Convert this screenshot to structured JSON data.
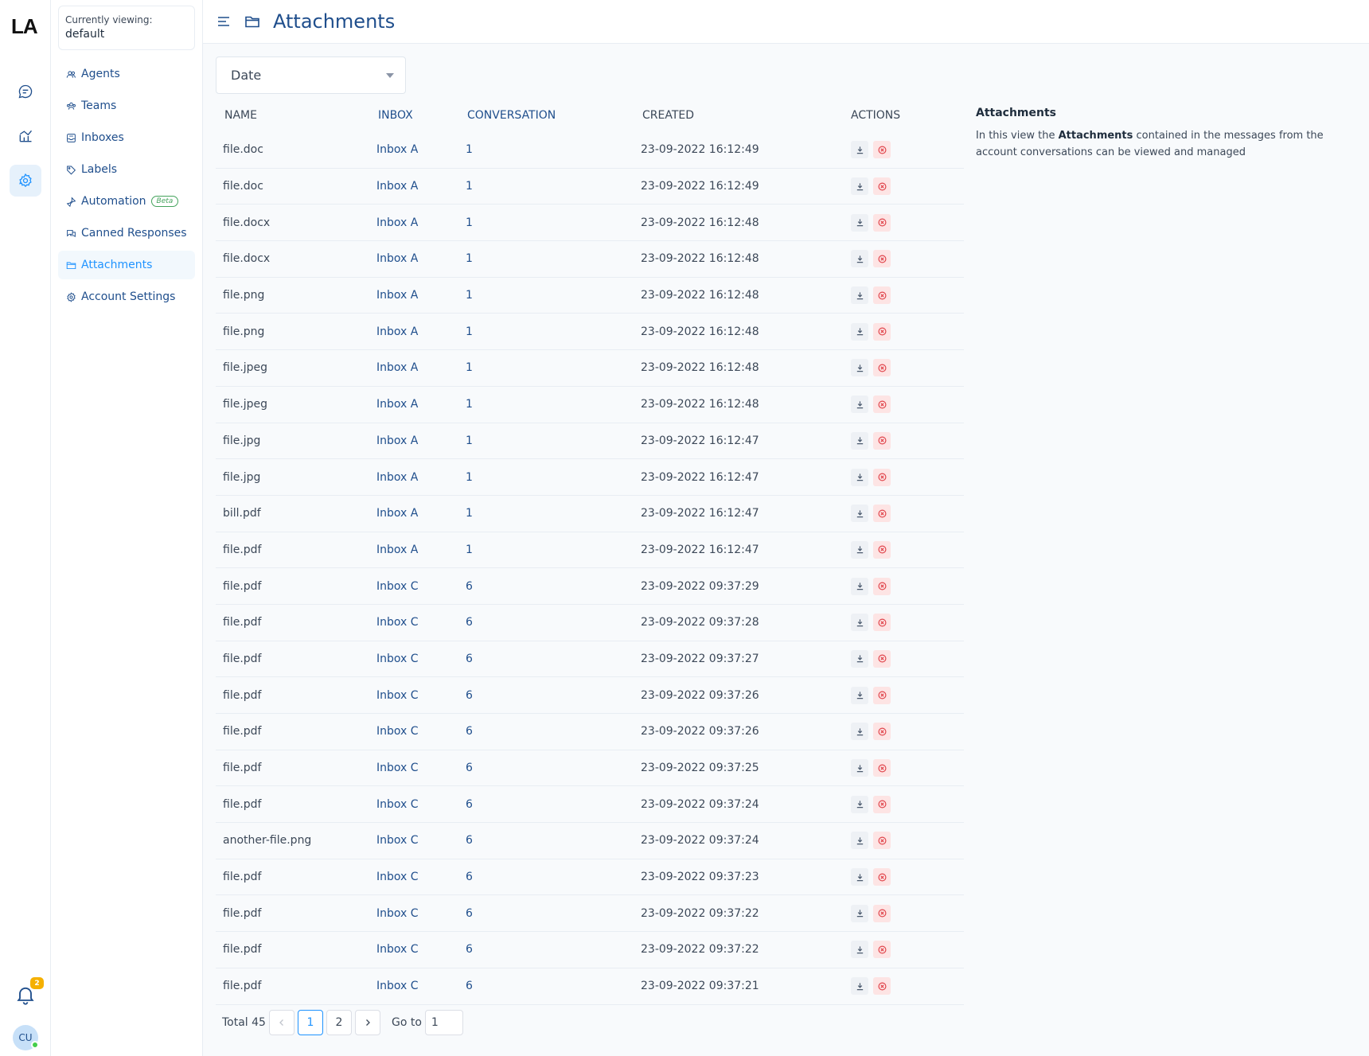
{
  "app": {
    "logo": "LA"
  },
  "rail": {
    "items": [
      {
        "name": "conversations",
        "icon": "chat-icon"
      },
      {
        "name": "reports",
        "icon": "chart-icon"
      },
      {
        "name": "settings",
        "icon": "gear-icon",
        "active": true
      }
    ],
    "notifications_count": "2",
    "avatar_initials": "CU"
  },
  "sidebar": {
    "viewing_label": "Currently viewing:",
    "viewing_value": "default",
    "items": [
      {
        "label": "Agents",
        "icon": "agents-icon"
      },
      {
        "label": "Teams",
        "icon": "teams-icon"
      },
      {
        "label": "Inboxes",
        "icon": "inbox-icon"
      },
      {
        "label": "Labels",
        "icon": "tag-icon"
      },
      {
        "label": "Automation",
        "icon": "automation-icon",
        "badge": "Beta"
      },
      {
        "label": "Canned Responses",
        "icon": "canned-icon"
      },
      {
        "label": "Attachments",
        "icon": "folder-icon",
        "active": true
      },
      {
        "label": "Account Settings",
        "icon": "gear-icon"
      }
    ]
  },
  "header": {
    "title": "Attachments"
  },
  "filter": {
    "selected": "Date"
  },
  "table": {
    "columns": [
      "NAME",
      "INBOX",
      "CONVERSATION",
      "CREATED",
      "ACTIONS"
    ],
    "rows": [
      [
        "file.doc",
        "Inbox A",
        "1",
        "23-09-2022 16:12:49"
      ],
      [
        "file.doc",
        "Inbox A",
        "1",
        "23-09-2022 16:12:49"
      ],
      [
        "file.docx",
        "Inbox A",
        "1",
        "23-09-2022 16:12:48"
      ],
      [
        "file.docx",
        "Inbox A",
        "1",
        "23-09-2022 16:12:48"
      ],
      [
        "file.png",
        "Inbox A",
        "1",
        "23-09-2022 16:12:48"
      ],
      [
        "file.png",
        "Inbox A",
        "1",
        "23-09-2022 16:12:48"
      ],
      [
        "file.jpeg",
        "Inbox A",
        "1",
        "23-09-2022 16:12:48"
      ],
      [
        "file.jpeg",
        "Inbox A",
        "1",
        "23-09-2022 16:12:48"
      ],
      [
        "file.jpg",
        "Inbox A",
        "1",
        "23-09-2022 16:12:47"
      ],
      [
        "file.jpg",
        "Inbox A",
        "1",
        "23-09-2022 16:12:47"
      ],
      [
        "bill.pdf",
        "Inbox A",
        "1",
        "23-09-2022 16:12:47"
      ],
      [
        "file.pdf",
        "Inbox A",
        "1",
        "23-09-2022 16:12:47"
      ],
      [
        "file.pdf",
        "Inbox C",
        "6",
        "23-09-2022 09:37:29"
      ],
      [
        "file.pdf",
        "Inbox C",
        "6",
        "23-09-2022 09:37:28"
      ],
      [
        "file.pdf",
        "Inbox C",
        "6",
        "23-09-2022 09:37:27"
      ],
      [
        "file.pdf",
        "Inbox C",
        "6",
        "23-09-2022 09:37:26"
      ],
      [
        "file.pdf",
        "Inbox C",
        "6",
        "23-09-2022 09:37:26"
      ],
      [
        "file.pdf",
        "Inbox C",
        "6",
        "23-09-2022 09:37:25"
      ],
      [
        "file.pdf",
        "Inbox C",
        "6",
        "23-09-2022 09:37:24"
      ],
      [
        "another-file.png",
        "Inbox C",
        "6",
        "23-09-2022 09:37:24"
      ],
      [
        "file.pdf",
        "Inbox C",
        "6",
        "23-09-2022 09:37:23"
      ],
      [
        "file.pdf",
        "Inbox C",
        "6",
        "23-09-2022 09:37:22"
      ],
      [
        "file.pdf",
        "Inbox C",
        "6",
        "23-09-2022 09:37:22"
      ],
      [
        "file.pdf",
        "Inbox C",
        "6",
        "23-09-2022 09:37:21"
      ]
    ]
  },
  "pagination": {
    "total_label": "Total 45",
    "pages": [
      "1",
      "2"
    ],
    "current_page": "1",
    "goto_label": "Go to",
    "goto_value": "1"
  },
  "info": {
    "title": "Attachments",
    "text_before": "In this view the ",
    "text_bold": "Attachments",
    "text_after": " contained in the messages from the account conversations can be viewed and managed"
  },
  "colors": {
    "accent": "#1f93ff",
    "link": "#1f4e8c",
    "danger": "#e0434a",
    "beta": "#44a35c",
    "badge": "#f5b000"
  }
}
